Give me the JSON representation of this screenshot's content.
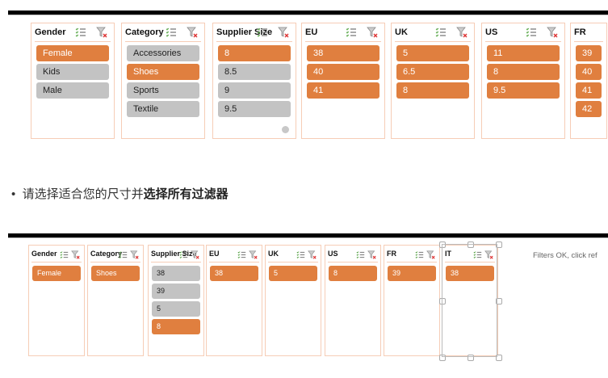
{
  "top_slicers": [
    {
      "title": "Gender",
      "items": [
        {
          "label": "Female",
          "selected": true
        },
        {
          "label": "Kids",
          "selected": false
        },
        {
          "label": "Male",
          "selected": false
        }
      ]
    },
    {
      "title": "Category",
      "items": [
        {
          "label": "Accessories",
          "selected": false
        },
        {
          "label": "Shoes",
          "selected": true
        },
        {
          "label": "Sports",
          "selected": false
        },
        {
          "label": "Textile",
          "selected": false
        }
      ]
    },
    {
      "title": "Supplier Size",
      "items": [
        {
          "label": "8",
          "selected": true
        },
        {
          "label": "8.5",
          "selected": false
        },
        {
          "label": "9",
          "selected": false
        },
        {
          "label": "9.5",
          "selected": false
        }
      ]
    },
    {
      "title": "EU",
      "items": [
        {
          "label": "38",
          "selected": true
        },
        {
          "label": "40",
          "selected": true
        },
        {
          "label": "41",
          "selected": true
        }
      ]
    },
    {
      "title": "UK",
      "items": [
        {
          "label": "5",
          "selected": true
        },
        {
          "label": "6.5",
          "selected": true
        },
        {
          "label": "8",
          "selected": true
        }
      ]
    },
    {
      "title": "US",
      "items": [
        {
          "label": "11",
          "selected": true
        },
        {
          "label": "8",
          "selected": true
        },
        {
          "label": "9.5",
          "selected": true
        }
      ]
    },
    {
      "title": "FR",
      "items": [
        {
          "label": "39",
          "selected": true
        },
        {
          "label": "40",
          "selected": true
        },
        {
          "label": "41",
          "selected": true
        },
        {
          "label": "42",
          "selected": true
        }
      ]
    }
  ],
  "instruction": {
    "normal": "请选择适合您的尺寸并",
    "bold": "选择所有过滤器"
  },
  "bottom_slicers": [
    {
      "title": "Gender",
      "items": [
        {
          "label": "Female",
          "selected": true
        }
      ]
    },
    {
      "title": "Category",
      "items": [
        {
          "label": "Shoes",
          "selected": true
        }
      ]
    },
    {
      "title": "Supplier Size",
      "items": [
        {
          "label": "38",
          "selected": false
        },
        {
          "label": "39",
          "selected": false
        },
        {
          "label": "5",
          "selected": false
        },
        {
          "label": "8",
          "selected": true
        }
      ]
    },
    {
      "title": "EU",
      "items": [
        {
          "label": "38",
          "selected": true
        }
      ]
    },
    {
      "title": "UK",
      "items": [
        {
          "label": "5",
          "selected": true
        }
      ]
    },
    {
      "title": "US",
      "items": [
        {
          "label": "8",
          "selected": true
        }
      ]
    },
    {
      "title": "FR",
      "items": [
        {
          "label": "39",
          "selected": true
        }
      ]
    },
    {
      "title": "IT",
      "items": [
        {
          "label": "38",
          "selected": true
        }
      ]
    }
  ],
  "status_text": "Filters OK, click ref",
  "colors": {
    "selected": "#e07f3f",
    "unselected": "#c3c3c3",
    "border": "#f6cdb6"
  }
}
